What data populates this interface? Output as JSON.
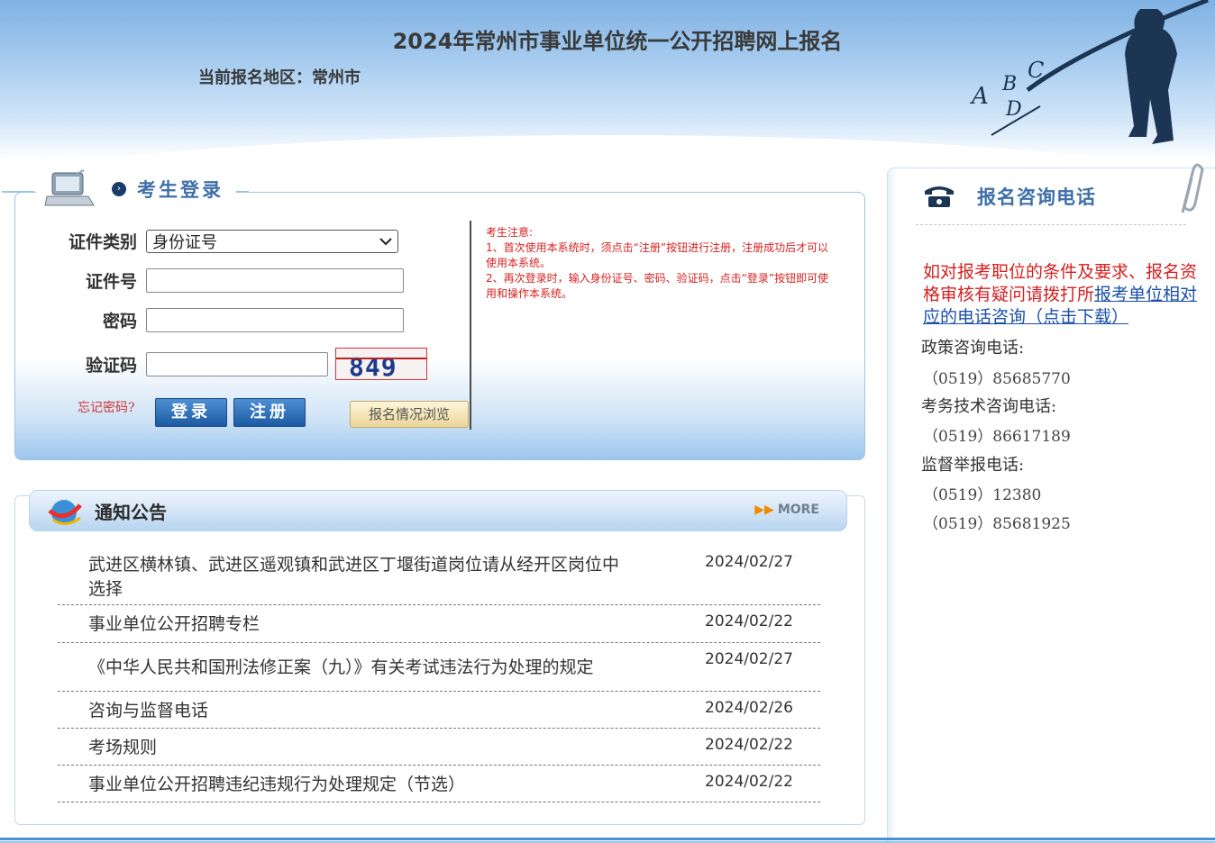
{
  "header": {
    "title": "2024年常州市事业单位统一公开招聘网上报名",
    "region": "当前报名地区：常州市",
    "art_letters": [
      "A",
      "B",
      "C",
      "D"
    ]
  },
  "login": {
    "heading": "考生登录",
    "id_type_label": "证件类别",
    "id_type_value": "身份证号",
    "id_number_label": "证件号",
    "password_label": "密码",
    "captcha_label": "验证码",
    "captcha_text": "849",
    "forgot": "忘记密码?",
    "login_btn": "登录",
    "register_btn": "注册",
    "browse_btn": "报名情况浏览",
    "notice_title": "考生注意:",
    "notice_1": "1、首次使用本系统时，须点击“注册”按钮进行注册，注册成功后才可以使用本系统。",
    "notice_2": "2、再次登录时，输入身份证号、密码、验证码，点击“登录”按钮即可使用和操作本系统。"
  },
  "news": {
    "title": "通知公告",
    "more": "MORE",
    "items": [
      {
        "title": "武进区横林镇、武进区遥观镇和武进区丁堰街道岗位请从经开区岗位中选择",
        "date": "2024/02/27"
      },
      {
        "title": "事业单位公开招聘专栏",
        "date": "2024/02/22"
      },
      {
        "title": "《中华人民共和国刑法修正案（九）》有关考试违法行为处理的规定",
        "date": "2024/02/27"
      },
      {
        "title": "咨询与监督电话",
        "date": "2024/02/26"
      },
      {
        "title": "考场规则",
        "date": "2024/02/22"
      },
      {
        "title": "事业单位公开招聘违纪违规行为处理规定（节选）",
        "date": "2024/02/22"
      }
    ]
  },
  "consult": {
    "title": "报名咨询电话",
    "text": "如对报考职位的条件及要求、报名资格审核有疑问请拨打所",
    "link": "报考单位相对应的电话咨询（点击下载）",
    "policy_label": "政策咨询电话:",
    "policy_phone": "（0519）85685770",
    "tech_label": "考务技术咨询电话:",
    "tech_phone": "（0519）86617189",
    "supervise_label": "监督举报电话:",
    "supervise_phone_1": "（0519）12380",
    "supervise_phone_2": "（0519）85681925"
  },
  "colors": {
    "accent_blue": "#3f6fa8",
    "notice_red": "#d61f1f",
    "button_blue": "#1c5aa3"
  }
}
